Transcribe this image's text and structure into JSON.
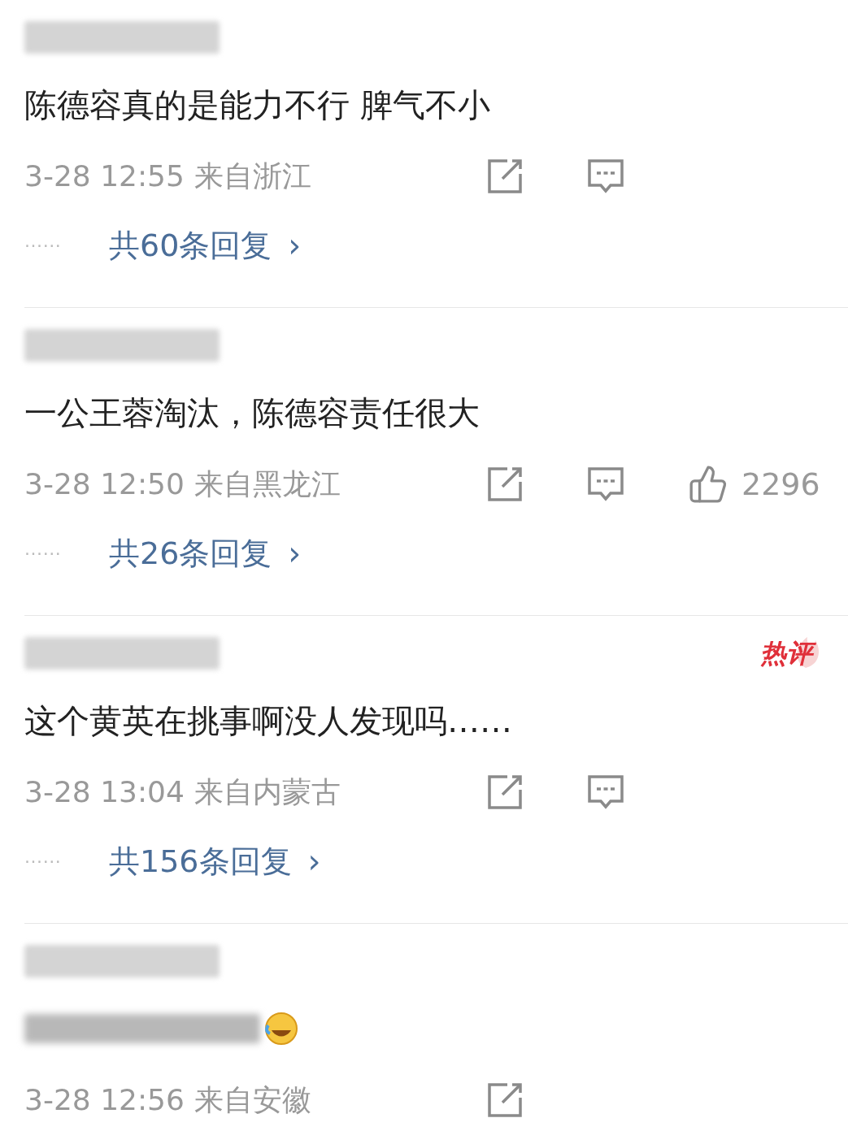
{
  "comments": [
    {
      "redacted": false,
      "text": "陈德容真的是能力不行 脾气不小",
      "hot": false,
      "time": "3-28 12:55",
      "location": "来自浙江",
      "actions": [
        {
          "kind": "share"
        },
        {
          "kind": "comment"
        }
      ],
      "reply_dots": "······",
      "replies": "共60条回复",
      "reply_arrow": "›"
    },
    {
      "redacted": false,
      "text": "一公王蓉淘汰，陈德容责任很大",
      "hot": false,
      "time": "3-28 12:50",
      "location": "来自黑龙江",
      "actions": [
        {
          "kind": "share"
        },
        {
          "kind": "comment"
        },
        {
          "kind": "like",
          "count": "2296"
        }
      ],
      "reply_dots": "······",
      "replies": "共26条回复",
      "reply_arrow": "›"
    },
    {
      "redacted": false,
      "text": "这个黄英在挑事啊没人发现吗……",
      "hot": true,
      "hot_label": "热评",
      "time": "3-28 13:04",
      "location": "来自内蒙古",
      "actions": [
        {
          "kind": "share"
        },
        {
          "kind": "comment"
        }
      ],
      "reply_dots": "······",
      "replies": "共156条回复",
      "reply_arrow": "›"
    },
    {
      "redacted": true,
      "hot": false,
      "time": "3-28 12:56",
      "location": "来自安徽",
      "actions": [
        {
          "kind": "share"
        }
      ]
    }
  ]
}
